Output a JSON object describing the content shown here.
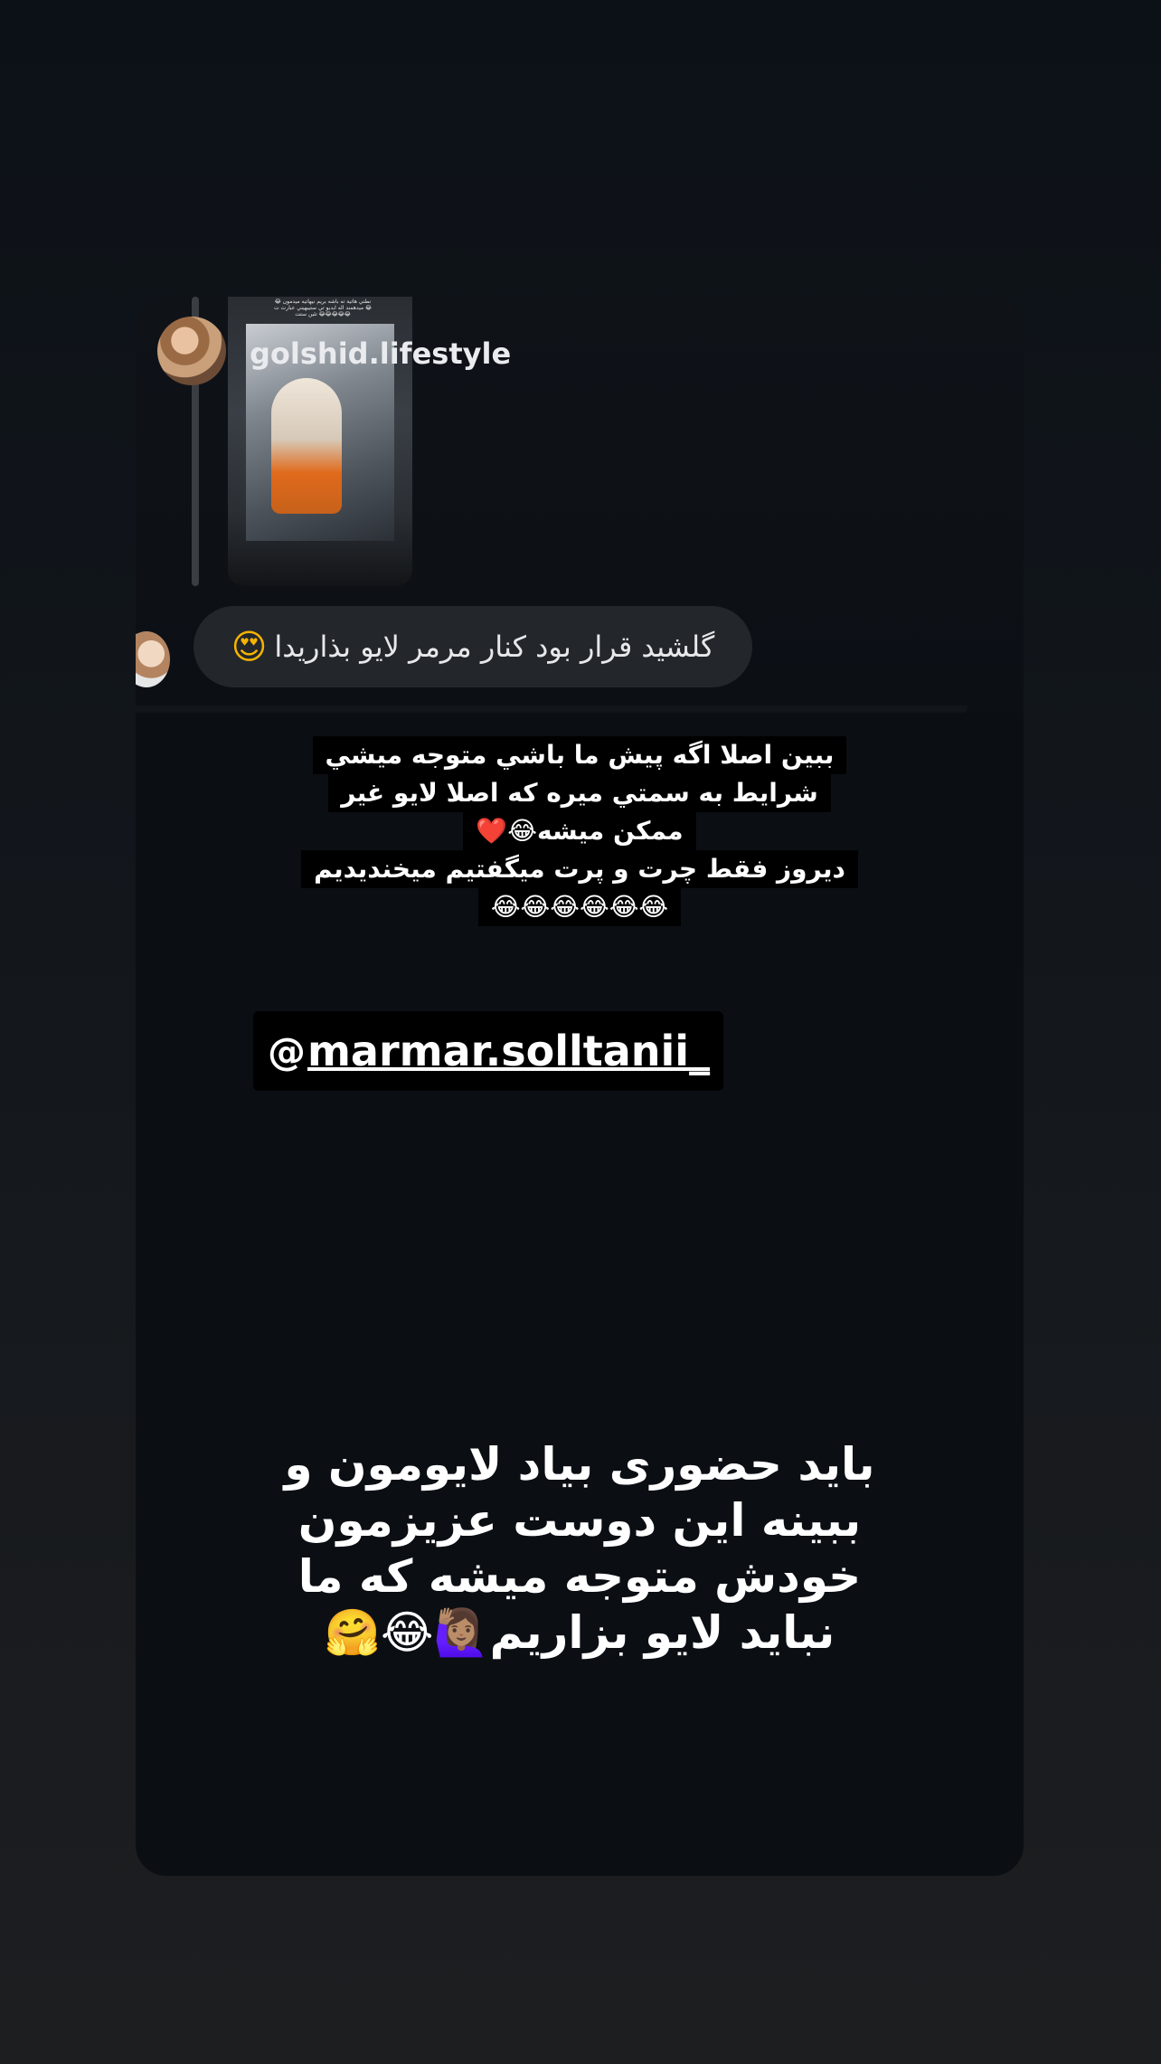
{
  "reply": {
    "username": "golshid.lifestyle",
    "thumb_caption": "نطني هاتية ته باشه بريم نيهاتيه ميدمون 😂😂 ميدهمند اله ابديو تي ستيبهيني عبارت ت تئين ستت 😂😂😂😂😂"
  },
  "comment": {
    "text": "گلشید قرار بود کنار مرمر لایو بذاریدا",
    "emoji": "😍"
  },
  "caption": {
    "lines": [
      "ببین اصلا اگه پیش ما باشي متوجه میشي",
      "شرایط به سمتي میره که اصلا لایو غیر",
      "ممکن میشه😂❤️",
      "دیروز فقط چرت و پرت میگفتیم میخندیدیم",
      "😂😂😂😂😂😂"
    ]
  },
  "mention": {
    "icon": "@",
    "handle": "marmar.solltanii_"
  },
  "bottom_caption": {
    "lines": [
      "باید حضوری بیاد لایومون و",
      "ببینه این دوست عزیزمون",
      "خودش متوجه میشه که ما",
      "نباید لایو بزاریم🙋🏽‍♀️😂🤗"
    ]
  }
}
